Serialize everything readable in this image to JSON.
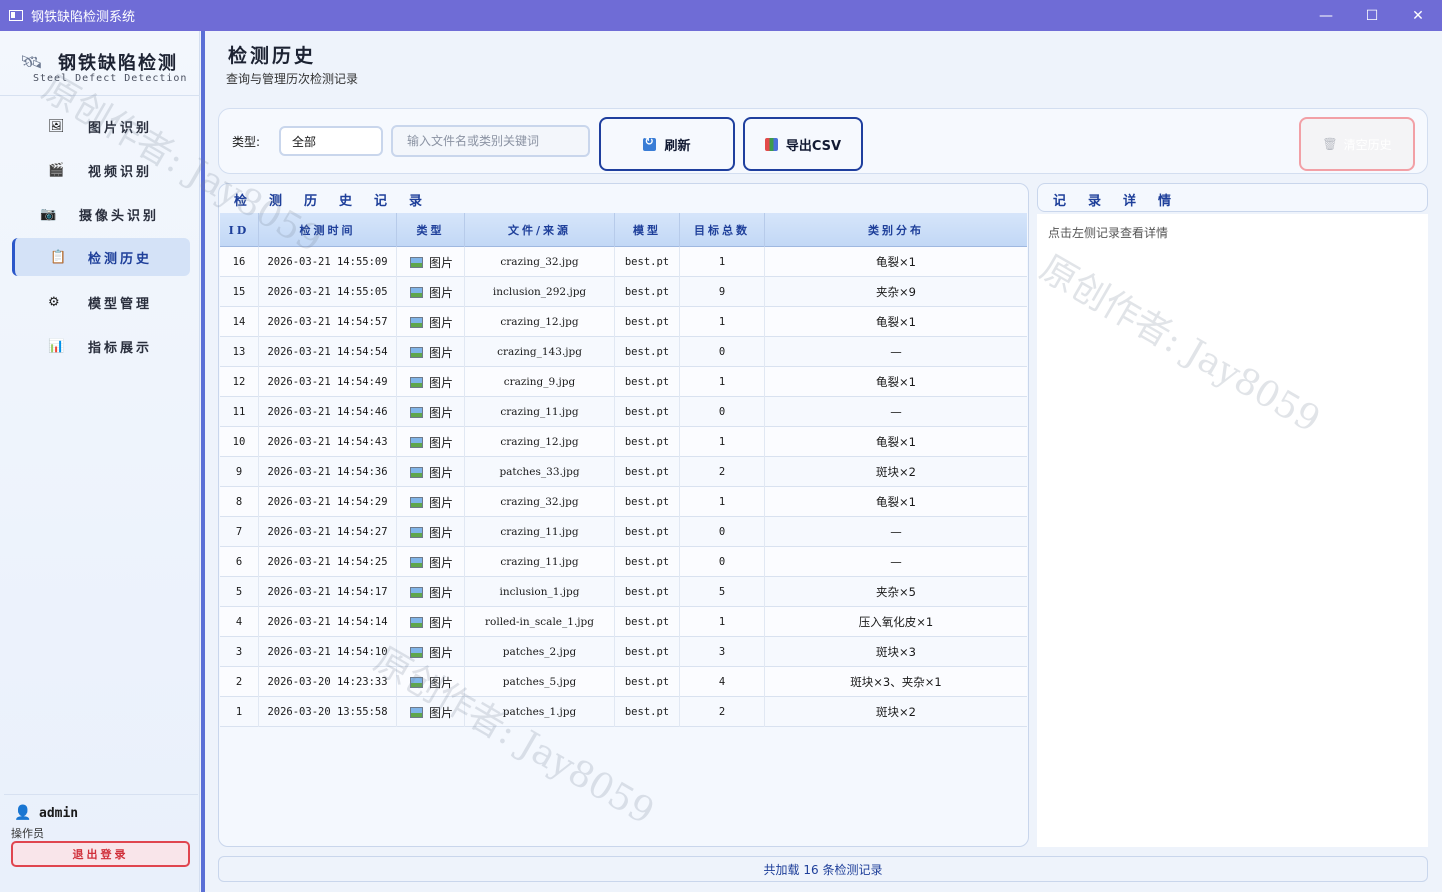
{
  "window": {
    "title": "钢铁缺陷检测系统",
    "min": "—",
    "max": "☐",
    "close": "✕"
  },
  "sidebar": {
    "logo_title": "钢铁缺陷检测",
    "logo_subtitle": "Steel Defect Detection",
    "items": [
      {
        "label": "图片识别",
        "icon": "image-icon"
      },
      {
        "label": "视频识别",
        "icon": "video-icon"
      },
      {
        "label": "摄像头识别",
        "icon": "camera-icon"
      },
      {
        "label": "检测历史",
        "icon": "clipboard-icon",
        "active": true
      },
      {
        "label": "模型管理",
        "icon": "gear-icon"
      },
      {
        "label": "指标展示",
        "icon": "bar-chart-icon"
      }
    ],
    "user": {
      "name": "admin",
      "role": "操作员",
      "logout": "退出登录"
    }
  },
  "header": {
    "title": "检测历史",
    "subtitle": "查询与管理历次检测记录"
  },
  "toolbar": {
    "type_label": "类型:",
    "type_value": "全部",
    "search_placeholder": "输入文件名或类别关键词",
    "refresh": "刷新",
    "export": "导出CSV",
    "clear": "清空历史"
  },
  "table": {
    "title": "检测历史记录",
    "columns": [
      "ID",
      "检测时间",
      "类型",
      "文件/来源",
      "模型",
      "目标总数",
      "类别分布"
    ],
    "rows": [
      [
        "16",
        "2026-03-21 14:55:09",
        "图片",
        "crazing_32.jpg",
        "best.pt",
        "1",
        "龟裂×1"
      ],
      [
        "15",
        "2026-03-21 14:55:05",
        "图片",
        "inclusion_292.jpg",
        "best.pt",
        "9",
        "夹杂×9"
      ],
      [
        "14",
        "2026-03-21 14:54:57",
        "图片",
        "crazing_12.jpg",
        "best.pt",
        "1",
        "龟裂×1"
      ],
      [
        "13",
        "2026-03-21 14:54:54",
        "图片",
        "crazing_143.jpg",
        "best.pt",
        "0",
        "—"
      ],
      [
        "12",
        "2026-03-21 14:54:49",
        "图片",
        "crazing_9.jpg",
        "best.pt",
        "1",
        "龟裂×1"
      ],
      [
        "11",
        "2026-03-21 14:54:46",
        "图片",
        "crazing_11.jpg",
        "best.pt",
        "0",
        "—"
      ],
      [
        "10",
        "2026-03-21 14:54:43",
        "图片",
        "crazing_12.jpg",
        "best.pt",
        "1",
        "龟裂×1"
      ],
      [
        "9",
        "2026-03-21 14:54:36",
        "图片",
        "patches_33.jpg",
        "best.pt",
        "2",
        "斑块×2"
      ],
      [
        "8",
        "2026-03-21 14:54:29",
        "图片",
        "crazing_32.jpg",
        "best.pt",
        "1",
        "龟裂×1"
      ],
      [
        "7",
        "2026-03-21 14:54:27",
        "图片",
        "crazing_11.jpg",
        "best.pt",
        "0",
        "—"
      ],
      [
        "6",
        "2026-03-21 14:54:25",
        "图片",
        "crazing_11.jpg",
        "best.pt",
        "0",
        "—"
      ],
      [
        "5",
        "2026-03-21 14:54:17",
        "图片",
        "inclusion_1.jpg",
        "best.pt",
        "5",
        "夹杂×5"
      ],
      [
        "4",
        "2026-03-21 14:54:14",
        "图片",
        "rolled-in_scale_1.jpg",
        "best.pt",
        "1",
        "压入氧化皮×1"
      ],
      [
        "3",
        "2026-03-21 14:54:10",
        "图片",
        "patches_2.jpg",
        "best.pt",
        "3",
        "斑块×3"
      ],
      [
        "2",
        "2026-03-20 14:23:33",
        "图片",
        "patches_5.jpg",
        "best.pt",
        "4",
        "斑块×3、夹杂×1"
      ],
      [
        "1",
        "2026-03-20 13:55:58",
        "图片",
        "patches_1.jpg",
        "best.pt",
        "2",
        "斑块×2"
      ]
    ]
  },
  "detail": {
    "title": "记录详情",
    "hint": "点击左侧记录查看详情"
  },
  "status": {
    "text": "共加载 16 条检测记录"
  },
  "watermark": "原创作者: Jay8059"
}
